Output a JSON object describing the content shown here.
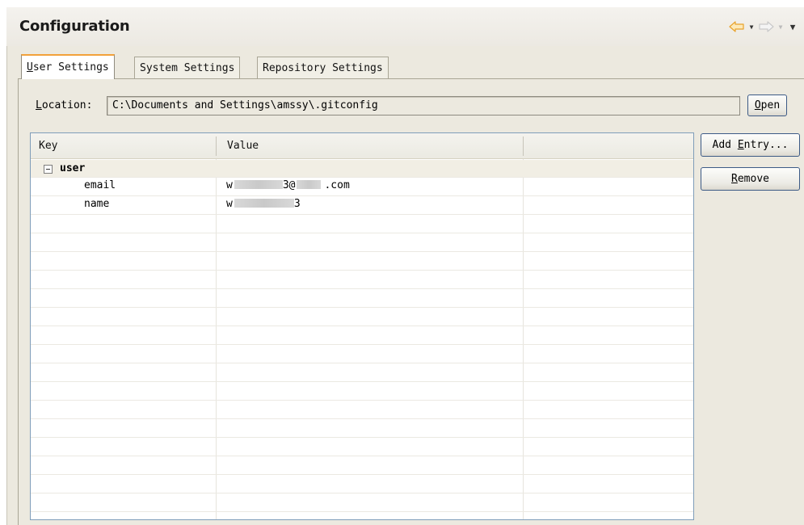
{
  "header": {
    "title": "Configuration",
    "back_icon": "back-arrow-icon",
    "forward_icon": "forward-arrow-icon",
    "menu_icon": "view-menu-icon"
  },
  "tabs": [
    {
      "label_first": "U",
      "label_rest": "ser Settings",
      "active": true
    },
    {
      "label": "System Settings",
      "active": false
    },
    {
      "label": "Repository Settings",
      "active": false
    }
  ],
  "location": {
    "label_first": "L",
    "label_rest": "ocation:",
    "value": "C:\\Documents and Settings\\amssy\\.gitconfig",
    "open_first": "O",
    "open_rest": "pen"
  },
  "table": {
    "columns": [
      "Key",
      "Value"
    ],
    "group": {
      "key": "user",
      "expanded": true
    },
    "rows": [
      {
        "key": "email",
        "value_prefix": "w",
        "value_mid": "3@",
        "value_suffix": ".com"
      },
      {
        "key": "name",
        "value_prefix": "w",
        "value_mid": "3",
        "value_suffix": ""
      }
    ]
  },
  "buttons": {
    "add_prefix": "Add ",
    "add_first": "E",
    "add_rest": "ntry...",
    "remove_first": "R",
    "remove_rest": "emove"
  },
  "colors": {
    "active_tab_accent": "#f2a13a",
    "panel_background": "#ece9df",
    "button_border": "#3c5a86",
    "nav_arrow": "#f3b33c"
  }
}
